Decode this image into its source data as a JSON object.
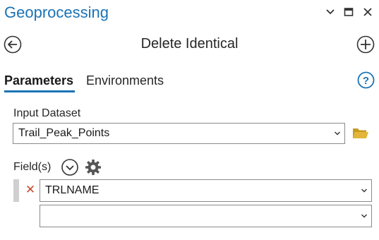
{
  "pane": {
    "title": "Geoprocessing",
    "accent": "#1a73b5"
  },
  "window_controls": [
    "chevron-down-icon",
    "maximize-icon",
    "close-icon"
  ],
  "tool": {
    "title": "Delete Identical"
  },
  "tabs": [
    {
      "label": "Parameters",
      "active": true
    },
    {
      "label": "Environments",
      "active": false
    }
  ],
  "params": {
    "input_dataset": {
      "label": "Input Dataset",
      "value": "Trail_Peak_Points"
    },
    "fields": {
      "label": "Field(s)",
      "rows": [
        {
          "value": "TRLNAME"
        },
        {
          "value": ""
        }
      ]
    }
  },
  "colors": {
    "remove": "#c94a2e",
    "folder": "#e2b63a"
  }
}
